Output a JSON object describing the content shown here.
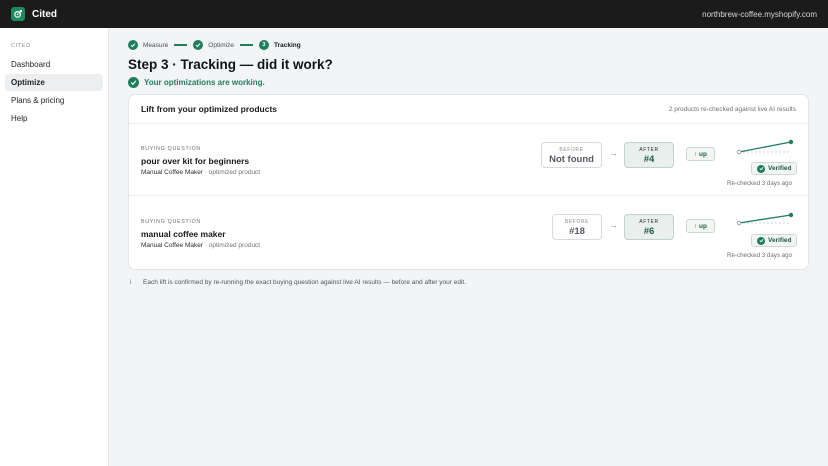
{
  "app": {
    "name": "Cited",
    "store": "northbrew-coffee.myshopify.com",
    "accent": "#1f7f5c"
  },
  "sidebar": {
    "heading": "CITED",
    "items": [
      {
        "label": "Dashboard",
        "active": false
      },
      {
        "label": "Optimize",
        "active": true
      },
      {
        "label": "Plans & pricing",
        "active": false
      },
      {
        "label": "Help",
        "active": false
      }
    ]
  },
  "stepper": {
    "steps": [
      {
        "label": "Measure",
        "state": "done"
      },
      {
        "label": "Optimize",
        "state": "done"
      },
      {
        "label": "Tracking",
        "state": "current",
        "number": "3"
      }
    ]
  },
  "page": {
    "title": "Step 3 · Tracking — did it work?",
    "status": "Your optimizations are working."
  },
  "card": {
    "title": "Lift from your optimized products",
    "note": "2 products re-checked against live AI results",
    "rows": [
      {
        "label": "BUYING QUESTION",
        "question": "pour over kit for beginners",
        "product": "Manual Coffee Maker",
        "product_suffix": " · optimized product",
        "before_label": "BEFORE",
        "before_value": "Not found",
        "after_label": "AFTER",
        "after_value": "#4",
        "trend": "up",
        "verified": "Verified",
        "rechecked": "Re-checked 3 days ago"
      },
      {
        "label": "BUYING QUESTION",
        "question": "manual coffee maker",
        "product": "Manual Coffee Maker",
        "product_suffix": " · optimized product",
        "before_label": "BEFORE",
        "before_value": "#18",
        "after_label": "AFTER",
        "after_value": "#6",
        "trend": "up",
        "verified": "Verified",
        "rechecked": "Re-checked 3 days ago"
      }
    ]
  },
  "footnote": "Each lift is confirmed by re-running the exact buying question against live AI results — before and after your edit."
}
